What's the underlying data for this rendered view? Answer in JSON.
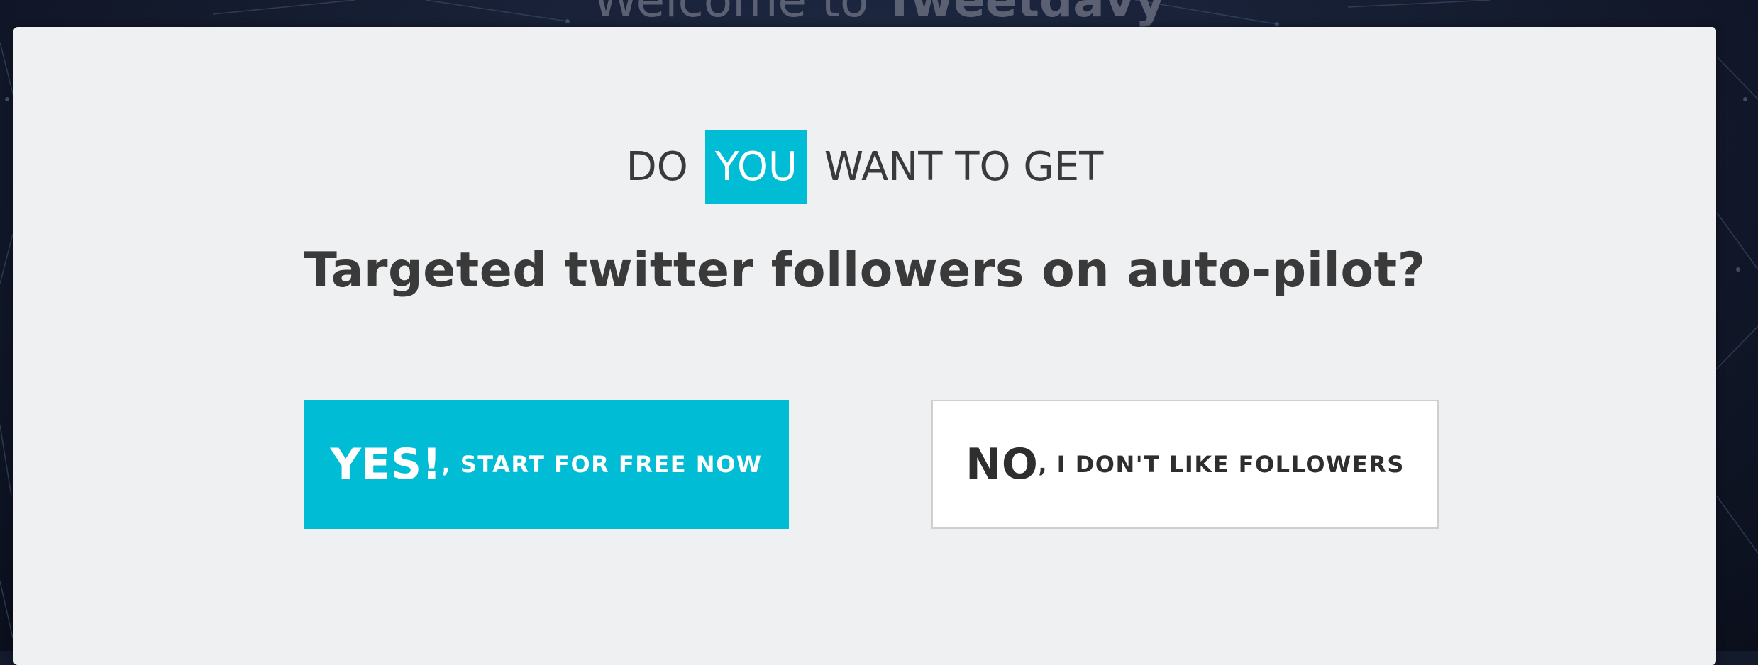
{
  "background": {
    "title_prefix": "Welcome to",
    "title_brand": "Tweetdavy"
  },
  "popup": {
    "headline_before": "DO",
    "headline_highlight": "YOU",
    "headline_after": "WANT TO GET",
    "subheadline": "Targeted twitter followers on auto-pilot?",
    "yes_button": {
      "emphasis": "YES!",
      "rest": ", START FOR FREE NOW"
    },
    "no_button": {
      "emphasis": "NO",
      "rest": ", I DON'T LIKE FOLLOWERS"
    }
  },
  "colors": {
    "accent": "#00bcd4",
    "modal_background": "#eff0f2",
    "text_dark": "#3a3a3a",
    "page_background": "#131a2c"
  }
}
